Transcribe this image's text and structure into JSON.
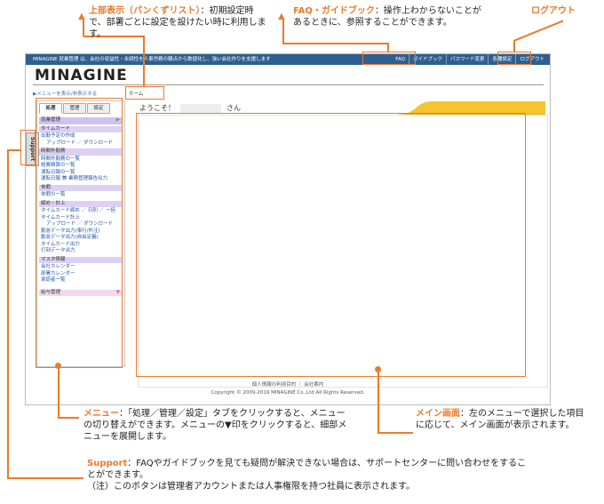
{
  "app": {
    "topbar_text": "MINAGINE 就業管理 は、会社の収益性・永続性を人事労務の観点から数値化し、強い会社作りを支援します",
    "top_nav": [
      "FAQ",
      "ガイドブック",
      "パスワード変更",
      "各種設定",
      "ログアウト"
    ],
    "logo": "MINAGINE",
    "menu_toggle": "▶メニューを表示/非表示する",
    "breadcrumb": "ホーム",
    "welcome_prefix": "ようこそ！",
    "welcome_suffix": "さん",
    "support_label": "Support"
  },
  "sidebar": {
    "tabs": [
      "処理",
      "管理",
      "設定"
    ],
    "header": "就業管理",
    "sections": [
      {
        "title": "タイムカード",
        "items": [
          "出勤予定の作成",
          "アップロード ／ ダウンロード"
        ]
      },
      {
        "title": "時間外勤務",
        "items": [
          "時間外勤務の一覧",
          "経費精算の一覧",
          "運転日報の一覧",
          "運転日報 兼 業務管理報告出力"
        ]
      },
      {
        "title": "休暇",
        "items": [
          "休暇の一覧"
        ]
      },
      {
        "title": "締め・計上",
        "items": [
          "タイムカード締め ／ 日別 ／ 一括",
          "タイムカード計上",
          "アップロード ／ ダウンロード",
          "勤怠データ出力(事行/外注)",
          "勤怠データ出力(自由定義)",
          "タイムカード出力",
          "打刻データ出力"
        ]
      },
      {
        "title": "マスタ情報",
        "items": [
          "会社カレンダー",
          "部署カレンダー",
          "承認者一覧"
        ]
      }
    ],
    "bottom": "給与管理"
  },
  "footer": {
    "links": "個人情報の利用目的 ｜ 会社案内",
    "copyright": "Copyright © 2009-2019 MINAGINE Co.,Ltd All Rights Reserved."
  },
  "callouts": {
    "breadcrumb": {
      "title": "上部表示（パンくずリスト）",
      "text": "：初期設定時で、部署ごとに設定を設けたい時に利用します。"
    },
    "faq": {
      "title": "FAQ・ガイドブック",
      "text": "：操作上わからないことがあるときに、参照することができます。"
    },
    "logout": {
      "title": "ログアウト"
    },
    "menu": {
      "title": "メニュー",
      "text": "：「処理／管理／設定」タブをクリックすると、メニューの切り替えができます。メニューの▼印をクリックすると、細部メニューを展開します。"
    },
    "main": {
      "title": "メイン画面",
      "text": "：左のメニューで選択した項目に応じて、メイン画面が表示されます。"
    },
    "support": {
      "title": "Support",
      "text": "：FAQやガイドブックを見ても疑問が解決できない場合は、サポートセンターに問い合わせをすることができます。",
      "note": "（注）このボタンは管理者アカウントまたは人事権限を持つ社員に表示されます。"
    }
  }
}
